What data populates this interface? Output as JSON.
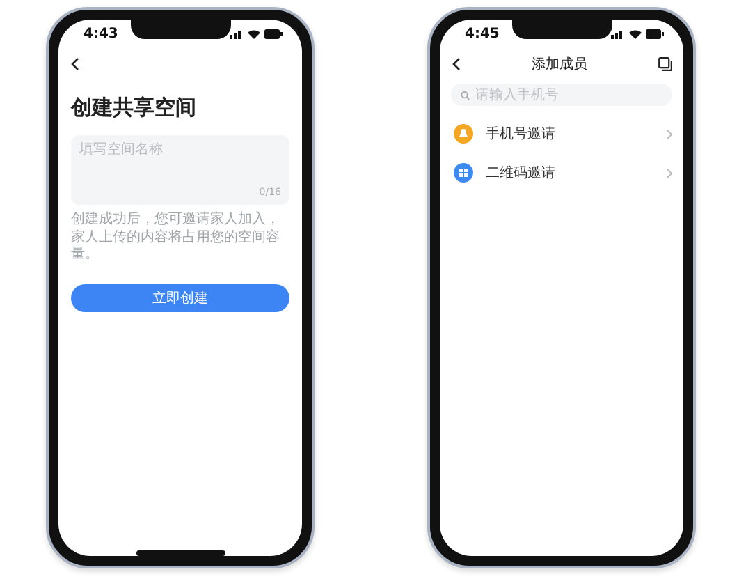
{
  "phones": [
    {
      "kind": "create",
      "time": "4:43",
      "home_indicator": true,
      "title": "创建共享空间",
      "name_field": {
        "placeholder": "填写空间名称",
        "counter": "0/16"
      },
      "note": "创建成功后，您可邀请家人加入，家人上传的内容将占用您的空间容量。",
      "button": "立即创建"
    },
    {
      "kind": "members",
      "time": "4:45",
      "home_indicator": false,
      "title": "添加成员",
      "search": {
        "placeholder": "请输入手机号"
      },
      "options": [
        {
          "label": "手机号邀请",
          "color": "#f5a623",
          "kind": "person"
        },
        {
          "label": "二维码邀请",
          "color": "#3d8bf0",
          "kind": "grid"
        }
      ]
    }
  ]
}
